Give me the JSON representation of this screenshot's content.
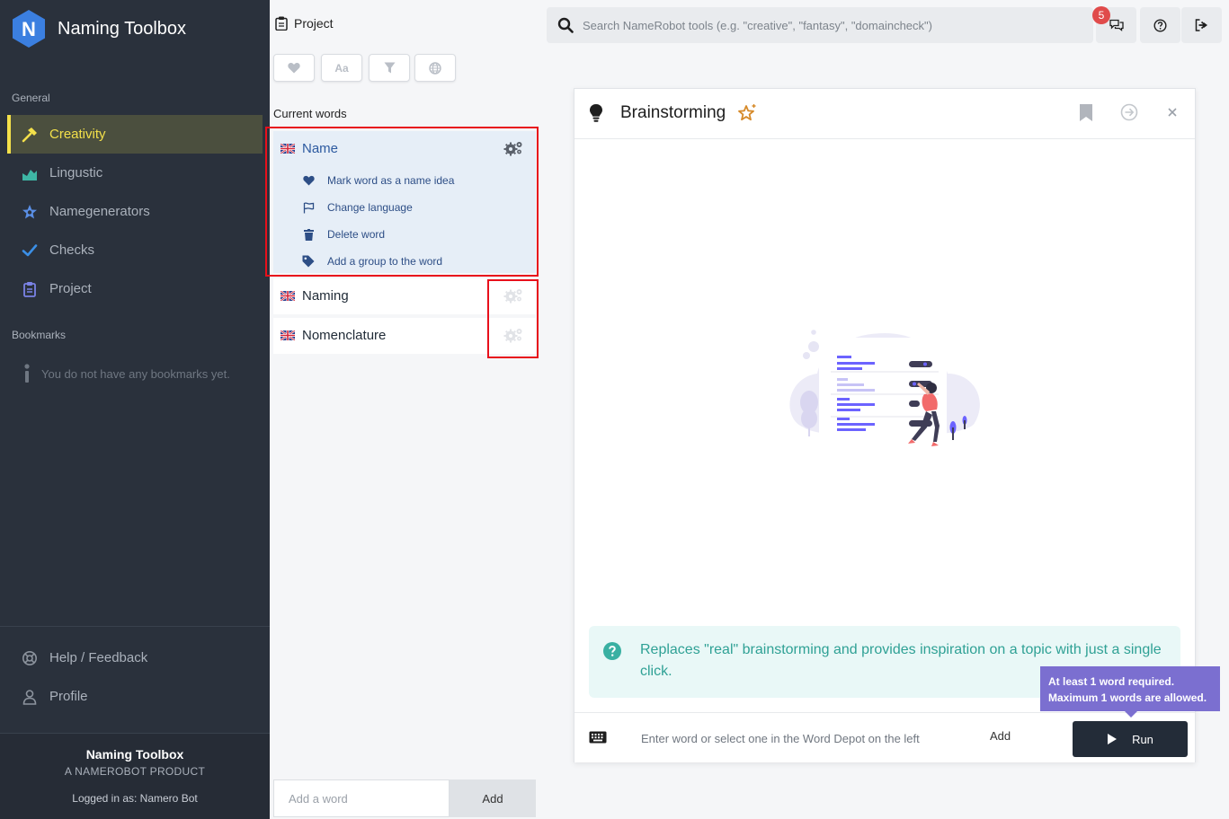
{
  "app": {
    "title": "Naming Toolbox",
    "logo_letter": "N"
  },
  "sidebar": {
    "general_label": "General",
    "items": [
      {
        "label": "Creativity",
        "icon": "hammer-icon",
        "active": true
      },
      {
        "label": "Lingustic",
        "icon": "chart-area-icon"
      },
      {
        "label": "Namegenerators",
        "icon": "star-bulb-icon"
      },
      {
        "label": "Checks",
        "icon": "check-icon"
      },
      {
        "label": "Project",
        "icon": "clipboard-icon"
      }
    ],
    "bookmarks_label": "Bookmarks",
    "bookmarks_empty": "You do not have any bookmarks yet.",
    "bottom_items": [
      {
        "label": "Help / Feedback",
        "icon": "lifebuoy-icon"
      },
      {
        "label": "Profile",
        "icon": "user-icon"
      }
    ],
    "footer": {
      "title": "Naming Toolbox",
      "subtitle": "A NAMEROBOT PRODUCT",
      "logged_in": "Logged in as: Namero Bot"
    }
  },
  "depot": {
    "header": "Project",
    "toolbar": {
      "font_label": "Aa"
    },
    "current_words_label": "Current words",
    "words": [
      {
        "text": "Name",
        "expanded": true,
        "actions": [
          {
            "label": "Mark word as a name idea",
            "icon": "heart-icon"
          },
          {
            "label": "Change language",
            "icon": "flag-icon"
          },
          {
            "label": "Delete word",
            "icon": "trash-icon"
          },
          {
            "label": "Add a group to the word",
            "icon": "tag-icon"
          }
        ]
      },
      {
        "text": "Naming"
      },
      {
        "text": "Nomenclature"
      }
    ],
    "add_placeholder": "Add a word",
    "add_button": "Add"
  },
  "topbar": {
    "search_placeholder": "Search NameRobot tools (e.g. \"creative\", \"fantasy\", \"domaincheck\")",
    "notifications_count": "5"
  },
  "tool": {
    "title": "Brainstorming",
    "description": "Replaces \"real\" brainstorming and provides inspiration on a topic with just a single click.",
    "input_placeholder": "Enter word or select one in the Word Depot on the left",
    "add_label": "Add",
    "run_label": "Run",
    "tooltip_line1": "At least 1 word required.",
    "tooltip_line2": "Maximum 1 words are allowed."
  },
  "colors": {
    "sidebar_bg": "#2a313c",
    "active_accent": "#f3e04a",
    "link_blue": "#2d4e86",
    "info_teal": "#2fa195",
    "tooltip_purple": "#7b6fd0",
    "run_bg": "#232c38",
    "highlight_red": "#e8101b"
  }
}
